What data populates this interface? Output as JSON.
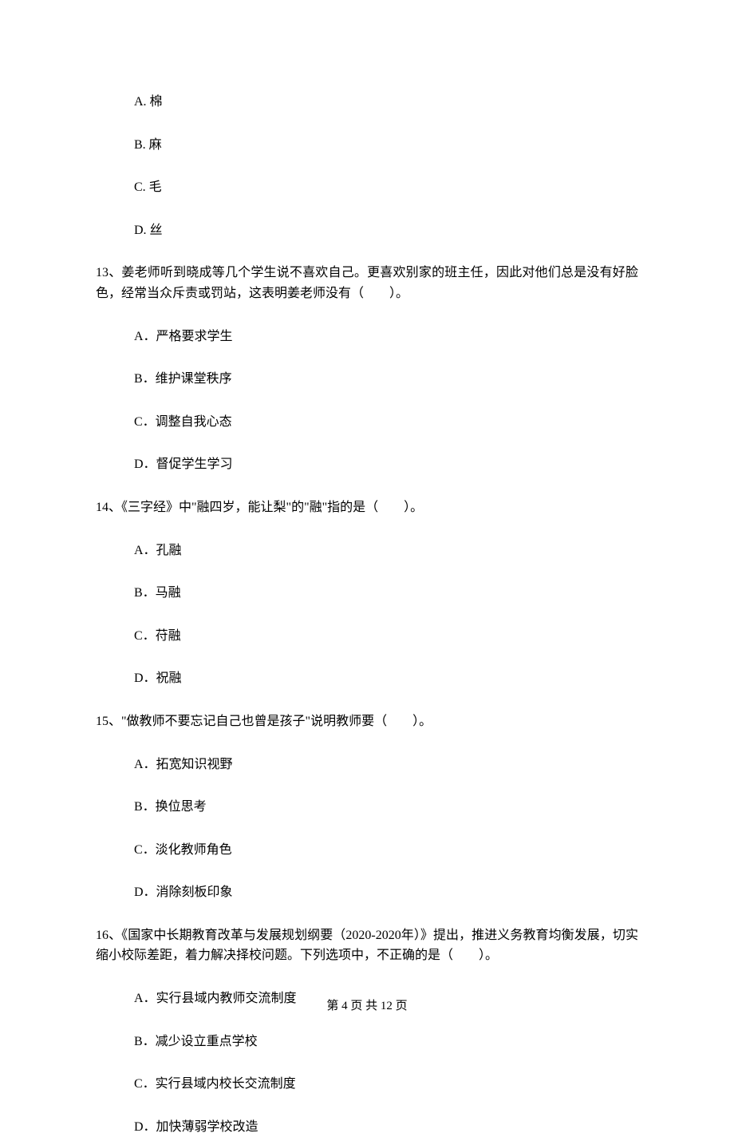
{
  "top_options": {
    "a": "A. 棉",
    "b": "B. 麻",
    "c": "C. 毛",
    "d": "D. 丝"
  },
  "q13": {
    "text": "13、姜老师听到晓成等几个学生说不喜欢自己。更喜欢别家的班主任，因此对他们总是没有好脸色，经常当众斥责或罚站，这表明姜老师没有（　　）。",
    "a": "A．严格要求学生",
    "b": "B．维护课堂秩序",
    "c": "C．调整自我心态",
    "d": "D．督促学生学习"
  },
  "q14": {
    "text": "14、《三字经》中\"融四岁，能让梨\"的\"融\"指的是（　　）。",
    "a": "A．孔融",
    "b": "B．马融",
    "c": "C．苻融",
    "d": "D．祝融"
  },
  "q15": {
    "text": "15、\"做教师不要忘记自己也曾是孩子\"说明教师要（　　）。",
    "a": "A．拓宽知识视野",
    "b": "B．换位思考",
    "c": "C．淡化教师角色",
    "d": "D．消除刻板印象"
  },
  "q16": {
    "text": "16、《国家中长期教育改革与发展规划纲要（2020-2020年）》提出，推进义务教育均衡发展，切实缩小校际差距，着力解决择校问题。下列选项中，不正确的是（　　）。",
    "a": "A．实行县域内教师交流制度",
    "b": "B．减少设立重点学校",
    "c": "C．实行县域内校长交流制度",
    "d": "D．加快薄弱学校改造"
  },
  "footer": "第 4 页 共 12 页"
}
